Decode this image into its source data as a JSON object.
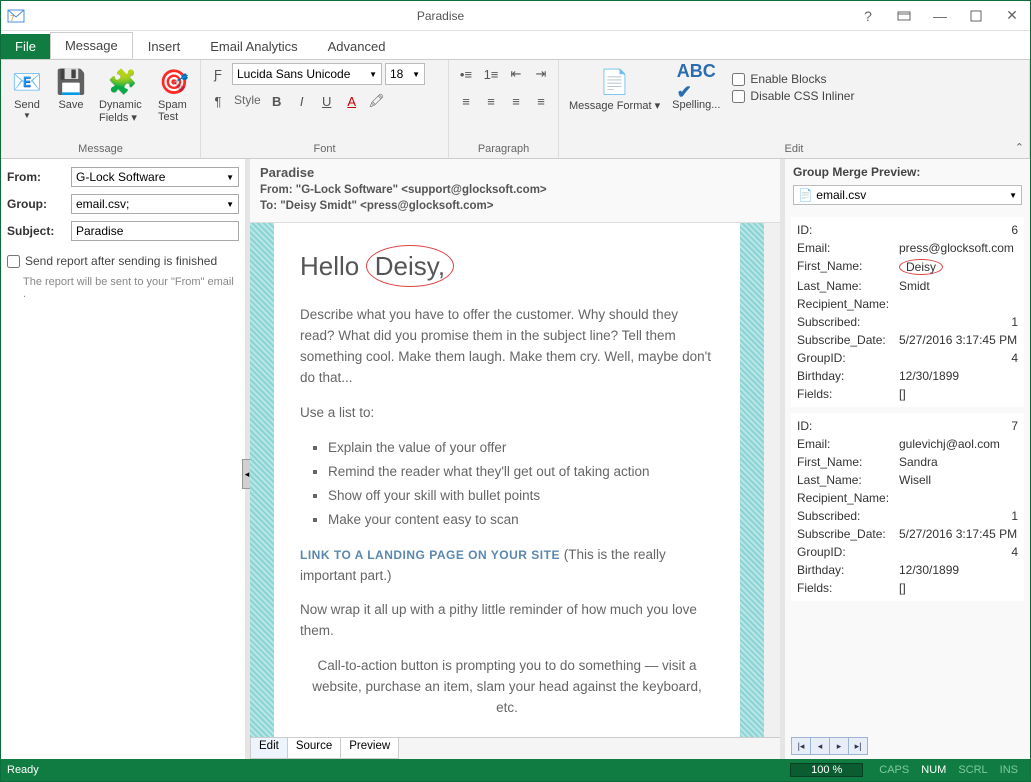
{
  "titlebar": {
    "title": "Paradise"
  },
  "tabs": {
    "file": "File",
    "items": [
      "Message",
      "Insert",
      "Email Analytics",
      "Advanced"
    ],
    "active": 0
  },
  "ribbon": {
    "send": "Send",
    "save": "Save",
    "dynamic_fields": "Dynamic Fields ▾",
    "spam_test": "Spam Test",
    "group_message": "Message",
    "font_name": "Lucida Sans Unicode",
    "font_size": "18",
    "style_label": "Style",
    "group_font": "Font",
    "group_paragraph": "Paragraph",
    "msg_format": "Message Format ▾",
    "spelling": "Spelling...",
    "enable_blocks": "Enable Blocks",
    "disable_css": "Disable CSS Inliner",
    "group_edit": "Edit"
  },
  "left": {
    "from_label": "From:",
    "from_value": "G-Lock Software",
    "group_label": "Group:",
    "group_value": "email.csv;",
    "subject_label": "Subject:",
    "subject_value": "Paradise",
    "report_check": "Send report after sending is finished",
    "report_note": "The report will be sent to your \"From\" email ."
  },
  "center": {
    "title": "Paradise",
    "from_line": "From: \"G-Lock Software\" <support@glocksoft.com>",
    "to_line": "To: \"Deisy Smidt\" <press@glocksoft.com>",
    "greeting_prefix": "Hello",
    "greeting_name": "Deisy,",
    "p1": "Describe what you have to offer the customer. Why should they read? What did you promise them in the subject line? Tell them something cool. Make them laugh. Make them cry. Well, maybe don't do that...",
    "list_intro": "Use a list to:",
    "bullets": [
      "Explain the value of your offer",
      "Remind the reader what they'll get out of taking action",
      "Show off your skill with bullet points",
      "Make your content easy to scan"
    ],
    "link_text": "LINK TO A LANDING PAGE ON YOUR SITE",
    "link_after": " (This is the really important part.)",
    "p2": "Now wrap it all up with a pithy little reminder of how much you love them.",
    "cta": "Call-to-action button is prompting you to do something — visit a website, purchase an item, slam your head against the keyboard, etc.",
    "editor_tabs": [
      "Edit",
      "Source",
      "Preview"
    ]
  },
  "right": {
    "header": "Group Merge Preview:",
    "source": "email.csv",
    "records": [
      {
        "ID": "6",
        "Email": "press@glocksoft.com",
        "First_Name": "Deisy",
        "Last_Name": "Smidt",
        "Recipient_Name": "",
        "Subscribed": "1",
        "Subscribe_Date": "5/27/2016 3:17:45 PM",
        "GroupID": "4",
        "Birthday": "12/30/1899",
        "Fields": "[]",
        "_circled": "First_Name"
      },
      {
        "ID": "7",
        "Email": "gulevichj@aol.com",
        "First_Name": "Sandra",
        "Last_Name": "Wisell",
        "Recipient_Name": "",
        "Subscribed": "1",
        "Subscribe_Date": "5/27/2016 3:17:45 PM",
        "GroupID": "4",
        "Birthday": "12/30/1899",
        "Fields": "[]"
      }
    ]
  },
  "status": {
    "ready": "Ready",
    "zoom": "100 %",
    "caps": "CAPS",
    "num": "NUM",
    "scrl": "SCRL",
    "ins": "INS"
  }
}
